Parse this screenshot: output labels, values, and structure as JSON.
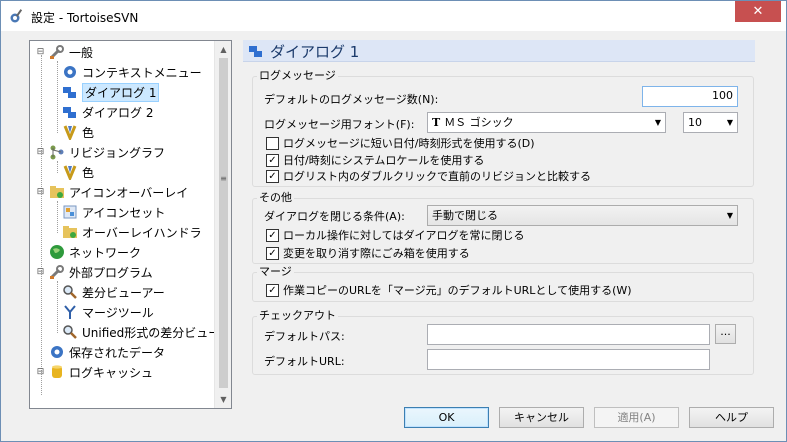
{
  "window": {
    "title": "設定 - TortoiseSVN",
    "close_glyph": "✕"
  },
  "tree": {
    "items": [
      {
        "label": "一般",
        "level": 0,
        "icon": "wrench-icon",
        "expander": "minus"
      },
      {
        "label": "コンテキストメニュー",
        "level": 1,
        "icon": "gear-icon"
      },
      {
        "label": "ダイアログ 1",
        "level": 1,
        "icon": "dialog-icon",
        "selected": true
      },
      {
        "label": "ダイアログ 2",
        "level": 1,
        "icon": "dialog-icon"
      },
      {
        "label": "色",
        "level": 1,
        "icon": "palette-icon"
      },
      {
        "label": "リビジョングラフ",
        "level": 0,
        "icon": "graph-icon",
        "expander": "minus"
      },
      {
        "label": "色",
        "level": 1,
        "icon": "palette-icon"
      },
      {
        "label": "アイコンオーバーレイ",
        "level": 0,
        "icon": "folder-overlay-icon",
        "expander": "minus"
      },
      {
        "label": "アイコンセット",
        "level": 1,
        "icon": "iconset-icon"
      },
      {
        "label": "オーバーレイハンドラ",
        "level": 1,
        "icon": "folder-overlay-icon"
      },
      {
        "label": "ネットワーク",
        "level": 0,
        "icon": "globe-icon"
      },
      {
        "label": "外部プログラム",
        "level": 0,
        "icon": "wrench-icon",
        "expander": "minus"
      },
      {
        "label": "差分ビューアー",
        "level": 1,
        "icon": "magnifier-icon"
      },
      {
        "label": "マージツール",
        "level": 1,
        "icon": "merge-icon"
      },
      {
        "label": "Unified形式の差分ビュー",
        "level": 1,
        "icon": "magnifier-icon"
      },
      {
        "label": "保存されたデータ",
        "level": 0,
        "icon": "gear-icon"
      },
      {
        "label": "ログキャッシュ",
        "level": 0,
        "icon": "database-icon",
        "expander": "minus"
      }
    ]
  },
  "page": {
    "title": "ダイアログ 1",
    "log_group": {
      "title": "ログメッセージ",
      "count_label": "デフォルトのログメッセージ数(N):",
      "count_value": "100",
      "font_label": "ログメッセージ用フォント(F):",
      "font_value": "ＭＳ ゴシック",
      "font_icon_glyph": "T",
      "font_size": "10",
      "checks": [
        {
          "label": "ログメッセージに短い日付/時刻形式を使用する(D)",
          "checked": false
        },
        {
          "label": "日付/時刻にシステムロケールを使用する",
          "checked": true
        },
        {
          "label": "ログリスト内のダブルクリックで直前のリビジョンと比較する",
          "checked": true
        }
      ]
    },
    "misc_group": {
      "title": "その他",
      "close_label": "ダイアログを閉じる条件(A):",
      "close_value": "手動で閉じる",
      "checks": [
        {
          "label": "ローカル操作に対してはダイアログを常に閉じる",
          "checked": true
        },
        {
          "label": "変更を取り消す際にごみ箱を使用する",
          "checked": true
        }
      ]
    },
    "merge_group": {
      "title": "マージ",
      "checks": [
        {
          "label": "作業コピーのURLを「マージ元」のデフォルトURLとして使用する(W)",
          "checked": true
        }
      ]
    },
    "checkout_group": {
      "title": "チェックアウト",
      "path_label": "デフォルトパス:",
      "path_value": "",
      "browse_label": "...",
      "url_label": "デフォルトURL:",
      "url_value": ""
    }
  },
  "buttons": {
    "ok": "OK",
    "cancel": "キャンセル",
    "apply": "適用(A)",
    "help": "ヘルプ"
  },
  "colors": {
    "accent": "#3c7fb1",
    "header_bg": "#dde6f6",
    "selection": "#cce8ff"
  }
}
